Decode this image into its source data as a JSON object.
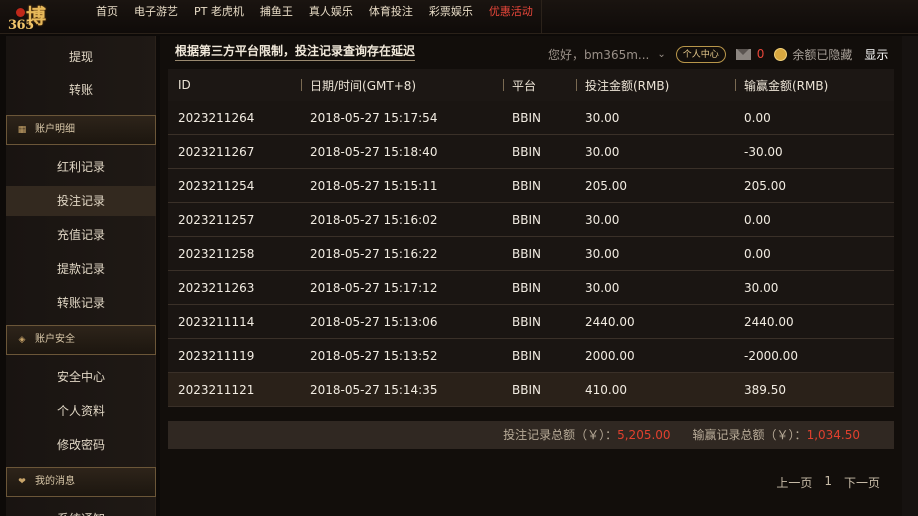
{
  "nav": {
    "logo_top": "博",
    "logo_bottom": "365",
    "items": [
      {
        "label": "首页"
      },
      {
        "label": "电子游艺"
      },
      {
        "label": "PT 老虎机"
      },
      {
        "label": "捕鱼王"
      },
      {
        "label": "真人娱乐"
      },
      {
        "label": "体育投注"
      },
      {
        "label": "彩票娱乐"
      },
      {
        "label": "优惠活动",
        "hot": true
      }
    ]
  },
  "sidebar": {
    "top_links": [
      "提现",
      "转账"
    ],
    "sections": [
      {
        "title": "账户明细",
        "items": [
          "红利记录",
          "投注记录",
          "充值记录",
          "提款记录",
          "转账记录"
        ]
      },
      {
        "title": "账户安全",
        "items": [
          "安全中心",
          "个人资料",
          "修改密码"
        ]
      },
      {
        "title": "我的消息",
        "items": [
          "系统通知"
        ]
      }
    ],
    "active_item": "投注记录"
  },
  "notice": "根据第三方平台限制，投注记录查询存在延迟",
  "userbar": {
    "greeting": "您好，bm365m...",
    "personal_center": "个人中心",
    "mail_count": "0",
    "balance_hidden": "余额已隐藏",
    "show": "显示"
  },
  "table": {
    "headers": [
      "ID",
      "日期/时间(GMT+8)",
      "平台",
      "投注金额(RMB)",
      "输赢金额(RMB)"
    ],
    "rows": [
      [
        "2023211264",
        "2018-05-27 15:17:54",
        "BBIN",
        "30.00",
        "0.00"
      ],
      [
        "2023211267",
        "2018-05-27 15:18:40",
        "BBIN",
        "30.00",
        "-30.00"
      ],
      [
        "2023211254",
        "2018-05-27 15:15:11",
        "BBIN",
        "205.00",
        "205.00"
      ],
      [
        "2023211257",
        "2018-05-27 15:16:02",
        "BBIN",
        "30.00",
        "0.00"
      ],
      [
        "2023211258",
        "2018-05-27 15:16:22",
        "BBIN",
        "30.00",
        "0.00"
      ],
      [
        "2023211263",
        "2018-05-27 15:17:12",
        "BBIN",
        "30.00",
        "30.00"
      ],
      [
        "2023211114",
        "2018-05-27 15:13:06",
        "BBIN",
        "2440.00",
        "2440.00"
      ],
      [
        "2023211119",
        "2018-05-27 15:13:52",
        "BBIN",
        "2000.00",
        "-2000.00"
      ],
      [
        "2023211121",
        "2018-05-27 15:14:35",
        "BBIN",
        "410.00",
        "389.50"
      ]
    ],
    "highlight_row": 8
  },
  "summary": {
    "bet_label": "投注记录总额（￥）：",
    "bet_total": "5,205.00",
    "win_label": "输赢记录总额（￥）：",
    "win_total": "1,034.50"
  },
  "pager": {
    "prev": "上一页",
    "current": "1",
    "next": "下一页"
  },
  "colors": {
    "accent_red": "#e0402e",
    "gold": "#e6b85a"
  }
}
